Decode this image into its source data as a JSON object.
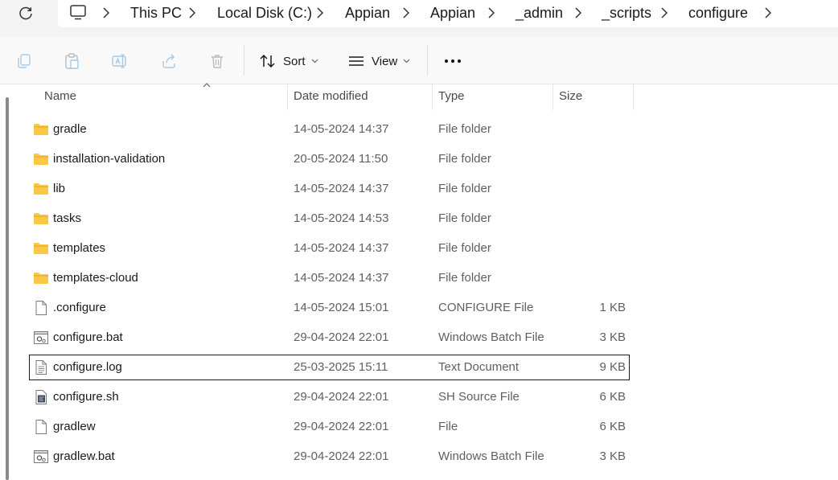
{
  "breadcrumb": [
    "This PC",
    "Local Disk (C:)",
    "Appian",
    "Appian",
    "_admin",
    "_scripts",
    "configure"
  ],
  "toolbar": {
    "sort_label": "Sort",
    "view_label": "View"
  },
  "columns": {
    "name": "Name",
    "date": "Date modified",
    "type": "Type",
    "size": "Size"
  },
  "files": [
    {
      "name": "gradle",
      "date": "14-05-2024 14:37",
      "type": "File folder",
      "size": "",
      "icon": "folder-icon"
    },
    {
      "name": "installation-validation",
      "date": "20-05-2024 11:50",
      "type": "File folder",
      "size": "",
      "icon": "folder-icon"
    },
    {
      "name": "lib",
      "date": "14-05-2024 14:37",
      "type": "File folder",
      "size": "",
      "icon": "folder-icon"
    },
    {
      "name": "tasks",
      "date": "14-05-2024 14:53",
      "type": "File folder",
      "size": "",
      "icon": "folder-icon"
    },
    {
      "name": "templates",
      "date": "14-05-2024 14:37",
      "type": "File folder",
      "size": "",
      "icon": "folder-icon"
    },
    {
      "name": "templates-cloud",
      "date": "14-05-2024 14:37",
      "type": "File folder",
      "size": "",
      "icon": "folder-icon"
    },
    {
      "name": ".configure",
      "date": "14-05-2024 15:01",
      "type": "CONFIGURE File",
      "size": "1 KB",
      "icon": "blank-file-icon"
    },
    {
      "name": "configure.bat",
      "date": "29-04-2024 22:01",
      "type": "Windows Batch File",
      "size": "3 KB",
      "icon": "batch-file-icon"
    },
    {
      "name": "configure.log",
      "date": "25-03-2025 15:11",
      "type": "Text Document",
      "size": "9 KB",
      "icon": "text-file-icon"
    },
    {
      "name": "configure.sh",
      "date": "29-04-2024 22:01",
      "type": "SH Source File",
      "size": "6 KB",
      "icon": "sh-file-icon"
    },
    {
      "name": "gradlew",
      "date": "29-04-2024 22:01",
      "type": "File",
      "size": "6 KB",
      "icon": "blank-file-icon"
    },
    {
      "name": "gradlew.bat",
      "date": "29-04-2024 22:01",
      "type": "Windows Batch File",
      "size": "3 KB",
      "icon": "batch-file-icon"
    }
  ],
  "colors": {
    "folder": "#f8c846",
    "folder_dark": "#e5a820",
    "selected_border": "#1a1a1a"
  }
}
